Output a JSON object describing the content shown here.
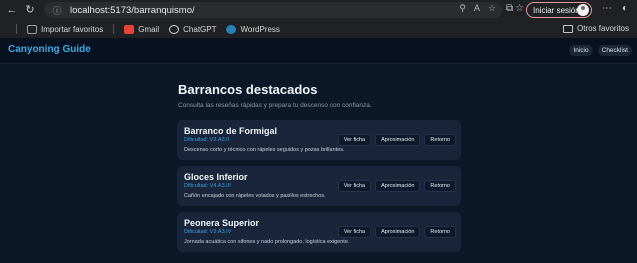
{
  "browser": {
    "url": "localhost:5173/barranquismo/",
    "signin_label": "Iniciar sesión",
    "bookmarks": [
      {
        "label": "Importar favoritos",
        "icon": "import-icon",
        "color": "#9aa0a6"
      },
      {
        "label": "Gmail",
        "icon": "gmail-icon",
        "color": "#ea4335"
      },
      {
        "label": "ChatGPT",
        "icon": "chatgpt-icon",
        "color": "#d8d8d8"
      },
      {
        "label": "WordPress",
        "icon": "wordpress-icon",
        "color": "#2a7fb8"
      }
    ],
    "other_favorites": "Otros favoritos"
  },
  "app": {
    "brand": "Canyoning Guide",
    "nav": [
      "Inicio",
      "Checklist"
    ],
    "accent": "#41a9e6"
  },
  "page": {
    "title": "Barrancos destacados",
    "subtitle": "Consulta las reseñas rápidas y prepara tu descenso con confianza.",
    "cards": [
      {
        "title": "Barranco de Formigal",
        "difficulty": "Dificultad: V3.A3.II",
        "description": "Descenso corto y técnico con rápeles seguidos y pozas brillantes.",
        "actions": [
          "Ver ficha",
          "Aproximación",
          "Retorno"
        ]
      },
      {
        "title": "Gloces Inferior",
        "difficulty": "Dificultad: V4.A3.III",
        "description": "Cañón encajado con rápeles volados y pasillos estrechos.",
        "actions": [
          "Ver ficha",
          "Aproximación",
          "Retorno"
        ]
      },
      {
        "title": "Peonera Superior",
        "difficulty": "Dificultad: V3.A3.IV",
        "description": "Jornada acuática con sifones y nado prolongado, logística exigente.",
        "actions": [
          "Ver ficha",
          "Aproximación",
          "Retorno"
        ]
      }
    ]
  }
}
